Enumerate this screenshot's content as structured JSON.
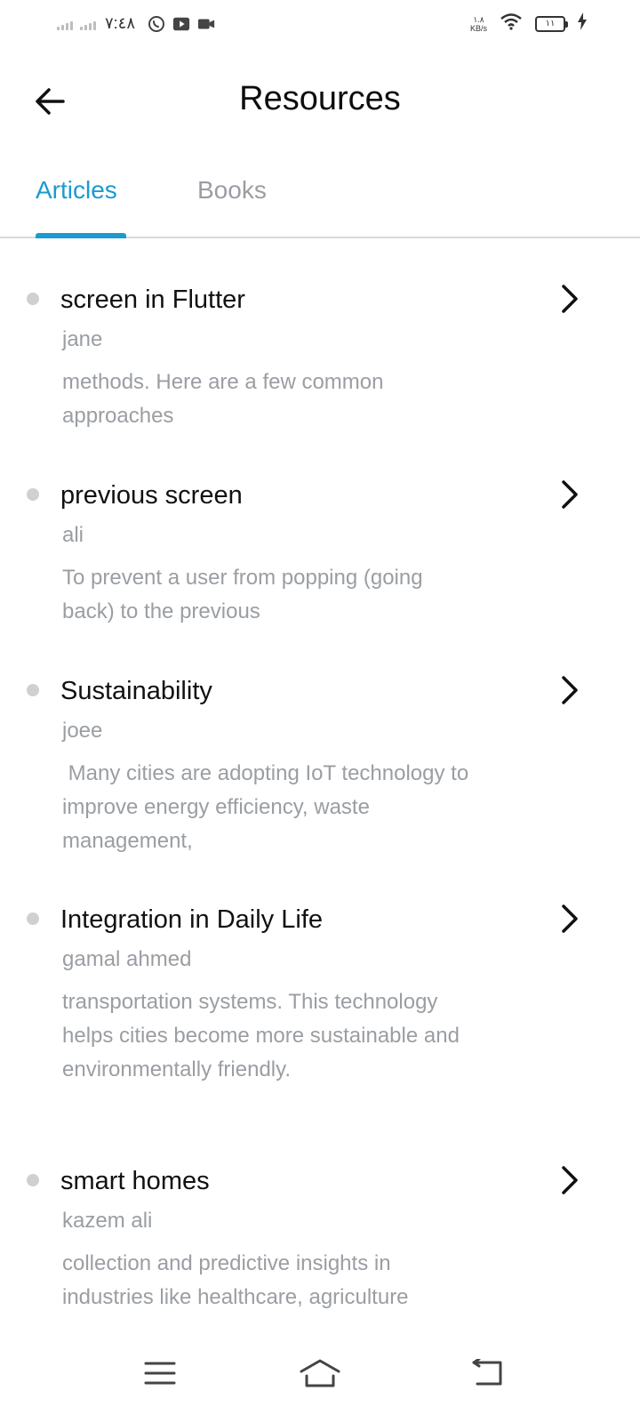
{
  "status_bar": {
    "time": "٧:٤٨",
    "net_speed_value": "١.٨",
    "net_speed_unit": "KB/s",
    "battery_level": "١١"
  },
  "header": {
    "title": "Resources"
  },
  "tabs": [
    {
      "label": "Articles",
      "active": true
    },
    {
      "label": "Books",
      "active": false
    }
  ],
  "articles": [
    {
      "title": "screen in Flutter",
      "author": "jane",
      "description": "methods. Here are a few common approaches"
    },
    {
      "title": "previous screen",
      "author": "ali",
      "description": "To prevent a user from popping (going back) to the previous"
    },
    {
      "title": "Sustainability",
      "author": "joee",
      "description": " Many cities are adopting IoT technology to improve energy efficiency, waste management,"
    },
    {
      "title": "Integration in Daily Life",
      "author": "gamal ahmed",
      "description": "transportation systems. This technology helps cities become more sustainable and environmentally friendly."
    },
    {
      "title": "smart homes",
      "author": "kazem ali",
      "description": "collection and predictive insights in industries like healthcare, agriculture"
    }
  ],
  "colors": {
    "accent": "#1a9bd0",
    "muted_text": "#9a9ea3",
    "divider": "#d9d9d9",
    "bullet": "#d0d0d0"
  }
}
